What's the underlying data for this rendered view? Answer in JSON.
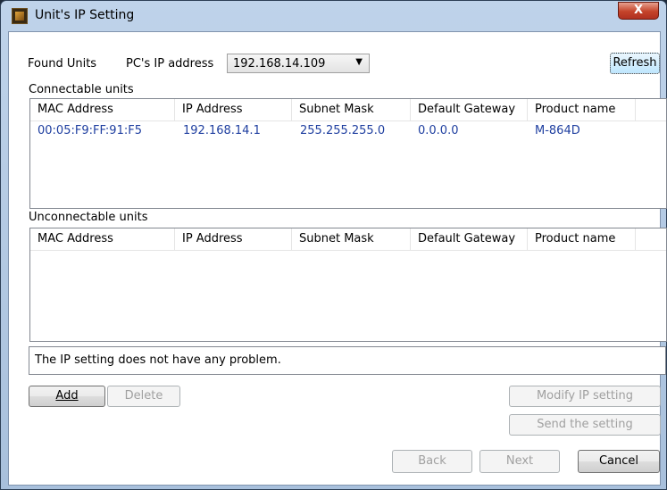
{
  "window": {
    "title": "Unit's IP Setting",
    "close_glyph": "X"
  },
  "found_units_label": "Found Units",
  "pc_ip_label": "PC's IP address",
  "pc_ip_value": "192.168.14.109",
  "refresh_label": "Refresh",
  "connectable": {
    "title": "Connectable units",
    "columns": [
      "MAC Address",
      "IP Address",
      "Subnet Mask",
      "Default Gateway",
      "Product name"
    ],
    "rows": [
      {
        "mac": "00:05:F9:FF:91:F5",
        "ip": "192.168.14.1",
        "mask": "255.255.255.0",
        "gateway": "0.0.0.0",
        "product": "M-864D"
      }
    ]
  },
  "unconnectable": {
    "title": "Unconnectable units",
    "columns": [
      "MAC Address",
      "IP Address",
      "Subnet Mask",
      "Default Gateway",
      "Product name"
    ],
    "rows": []
  },
  "status_message": "The IP setting does not have any problem.",
  "buttons": {
    "add": "Add",
    "delete": "Delete",
    "modify": "Modify IP setting",
    "send": "Send the setting",
    "back": "Back",
    "next": "Next",
    "cancel": "Cancel"
  },
  "icons": {
    "dropdown": "chevron-down-icon",
    "app": "app-icon"
  }
}
